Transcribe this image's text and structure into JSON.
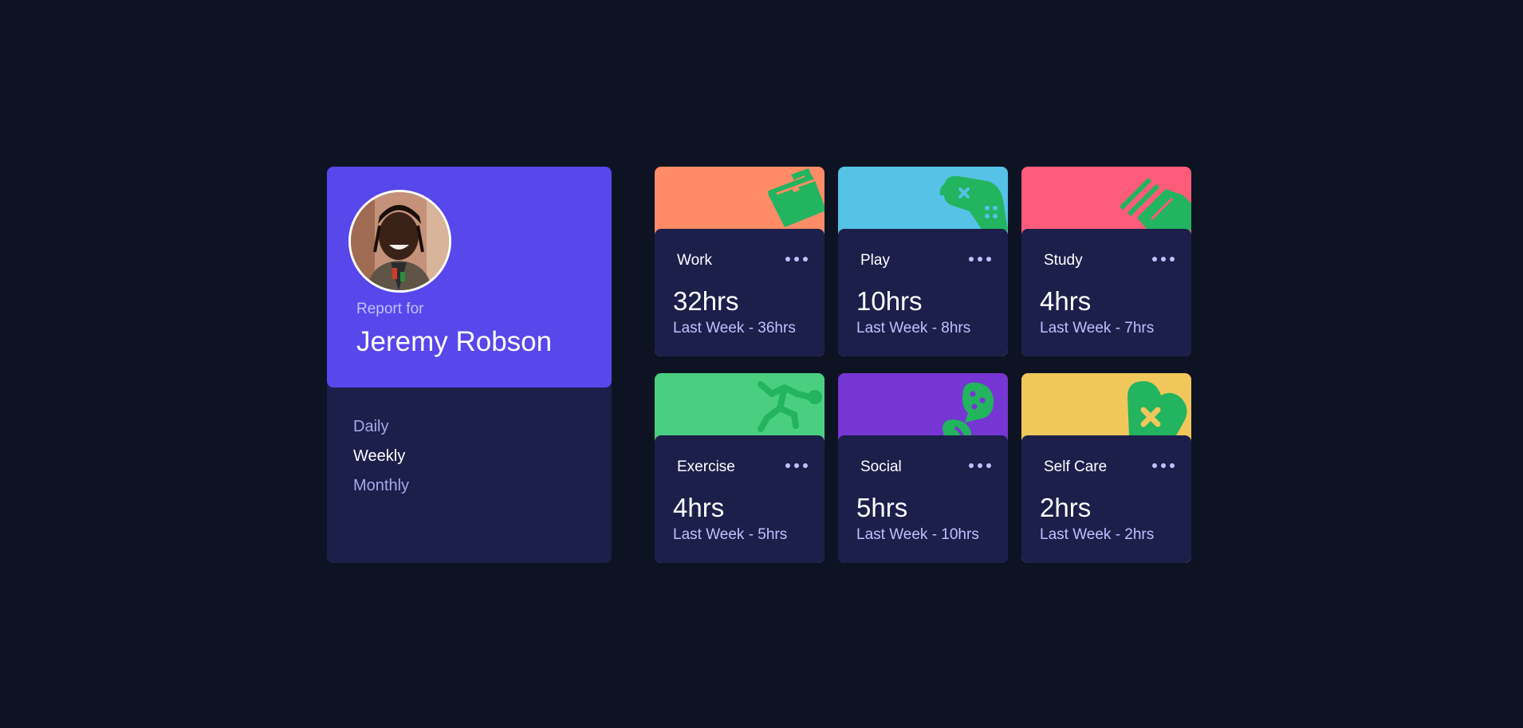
{
  "profile": {
    "report_label": "Report for",
    "name": "Jeremy Robson",
    "periods": [
      {
        "label": "Daily",
        "active": false
      },
      {
        "label": "Weekly",
        "active": true
      },
      {
        "label": "Monthly",
        "active": false
      }
    ]
  },
  "activities": [
    {
      "title": "Work",
      "hours": "32hrs",
      "previous": "Last Week - 36hrs",
      "color": "#ff8c66",
      "icon": "briefcase-icon"
    },
    {
      "title": "Play",
      "hours": "10hrs",
      "previous": "Last Week - 8hrs",
      "color": "#56c2e6",
      "icon": "gamepad-icon"
    },
    {
      "title": "Study",
      "hours": "4hrs",
      "previous": "Last Week - 7hrs",
      "color": "#ff5c7c",
      "icon": "book-icon"
    },
    {
      "title": "Exercise",
      "hours": "4hrs",
      "previous": "Last Week - 5hrs",
      "color": "#4acf81",
      "icon": "running-icon"
    },
    {
      "title": "Social",
      "hours": "5hrs",
      "previous": "Last Week - 10hrs",
      "color": "#7536d3",
      "icon": "chat-bubbles-icon"
    },
    {
      "title": "Self Care",
      "hours": "2hrs",
      "previous": "Last Week - 2hrs",
      "color": "#f1c75b",
      "icon": "heart-icon"
    }
  ],
  "icon_color": "#22b45e",
  "theme": {
    "background": "#0d1323",
    "card": "#1c1f4a",
    "profile_accent": "#5847eb",
    "muted_text": "#bdc1ff"
  }
}
